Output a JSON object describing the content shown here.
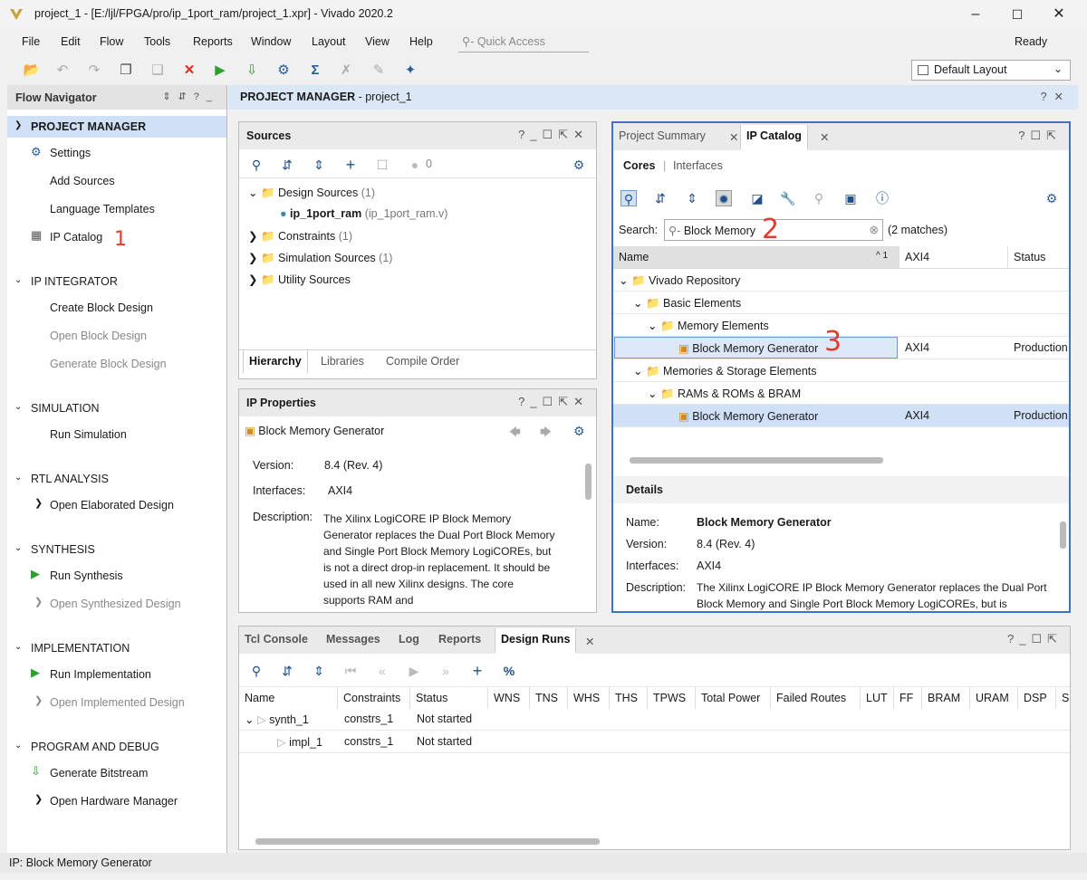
{
  "window": {
    "title": "project_1 - [E:/ljl/FPGA/pro/ip_1port_ram/project_1.xpr] - Vivado 2020.2",
    "status": "Ready"
  },
  "menu": [
    "File",
    "Edit",
    "Flow",
    "Tools",
    "Reports",
    "Window",
    "Layout",
    "View",
    "Help"
  ],
  "quick_access": {
    "placeholder": "Quick Access"
  },
  "layout_select": {
    "value": "Default Layout"
  },
  "flow_navigator": {
    "title": "Flow Navigator",
    "sections": [
      {
        "label": "PROJECT MANAGER",
        "items": [
          "Settings",
          "Add Sources",
          "Language Templates",
          "IP Catalog"
        ]
      },
      {
        "label": "IP INTEGRATOR",
        "items": [
          "Create Block Design",
          "Open Block Design",
          "Generate Block Design"
        ]
      },
      {
        "label": "SIMULATION",
        "items": [
          "Run Simulation"
        ]
      },
      {
        "label": "RTL ANALYSIS",
        "items": [
          "Open Elaborated Design"
        ]
      },
      {
        "label": "SYNTHESIS",
        "items": [
          "Run Synthesis",
          "Open Synthesized Design"
        ]
      },
      {
        "label": "IMPLEMENTATION",
        "items": [
          "Run Implementation",
          "Open Implemented Design"
        ]
      },
      {
        "label": "PROGRAM AND DEBUG",
        "items": [
          "Generate Bitstream",
          "Open Hardware Manager"
        ]
      }
    ]
  },
  "pm_header": {
    "title": "PROJECT MANAGER",
    "project": " - project_1"
  },
  "sources": {
    "title": "Sources",
    "count": "0",
    "tree": {
      "design_sources": "Design Sources",
      "design_count": "(1)",
      "file": "ip_1port_ram",
      "file_detail": "(ip_1port_ram.v)",
      "constraints": "Constraints",
      "constraints_count": "(1)",
      "simulation": "Simulation Sources",
      "simulation_count": "(1)",
      "utility": "Utility Sources"
    },
    "tabs": [
      "Hierarchy",
      "Libraries",
      "Compile Order"
    ]
  },
  "ip_properties": {
    "title": "IP Properties",
    "name": "Block Memory Generator",
    "version_label": "Version:",
    "version": "8.4 (Rev. 4)",
    "interfaces_label": "Interfaces:",
    "interfaces": "AXI4",
    "description_label": "Description:",
    "description": "The Xilinx LogiCORE IP Block Memory Generator replaces the Dual Port Block Memory and Single Port Block Memory LogiCOREs, but is not a direct drop-in replacement. It should be used in all new Xilinx designs. The core supports RAM and"
  },
  "catalog": {
    "tabs": [
      "Project Summary",
      "IP Catalog"
    ],
    "subtabs": [
      "Cores",
      "Interfaces"
    ],
    "search_label": "Search:",
    "search_value": "Block Memory",
    "matches": "(2 matches)",
    "columns": [
      "Name",
      "AXI4",
      "Status"
    ],
    "sort_hint": "^ 1",
    "rows": [
      {
        "name": "Vivado Repository",
        "axi": "",
        "status": ""
      },
      {
        "name": "Basic Elements",
        "axi": "",
        "status": ""
      },
      {
        "name": "Memory Elements",
        "axi": "",
        "status": ""
      },
      {
        "name": "Block Memory Generator",
        "axi": "AXI4",
        "status": "Production"
      },
      {
        "name": "Memories & Storage Elements",
        "axi": "",
        "status": ""
      },
      {
        "name": "RAMs & ROMs & BRAM",
        "axi": "",
        "status": ""
      },
      {
        "name": "Block Memory Generator",
        "axi": "AXI4",
        "status": "Production"
      }
    ],
    "details_title": "Details",
    "details": {
      "name_label": "Name:",
      "name": "Block Memory Generator",
      "version_label": "Version:",
      "version": "8.4 (Rev. 4)",
      "interfaces_label": "Interfaces:",
      "interfaces": "AXI4",
      "description_label": "Description:",
      "description": "The Xilinx LogiCORE IP Block Memory Generator replaces the Dual Port Block Memory and Single Port Block Memory LogiCOREs, but is"
    }
  },
  "bottom": {
    "tabs": [
      "Tcl Console",
      "Messages",
      "Log",
      "Reports",
      "Design Runs"
    ],
    "columns": [
      "Name",
      "Constraints",
      "Status",
      "WNS",
      "TNS",
      "WHS",
      "THS",
      "TPWS",
      "Total Power",
      "Failed Routes",
      "LUT",
      "FF",
      "BRAM",
      "URAM",
      "DSP",
      "S"
    ],
    "runs": [
      {
        "name": "synth_1",
        "constraints": "constrs_1",
        "status": "Not started"
      },
      {
        "name": "impl_1",
        "constraints": "constrs_1",
        "status": "Not started"
      }
    ]
  },
  "statusbar": {
    "text": "IP: Block Memory Generator"
  },
  "annotations": [
    "1",
    "2",
    "3"
  ]
}
